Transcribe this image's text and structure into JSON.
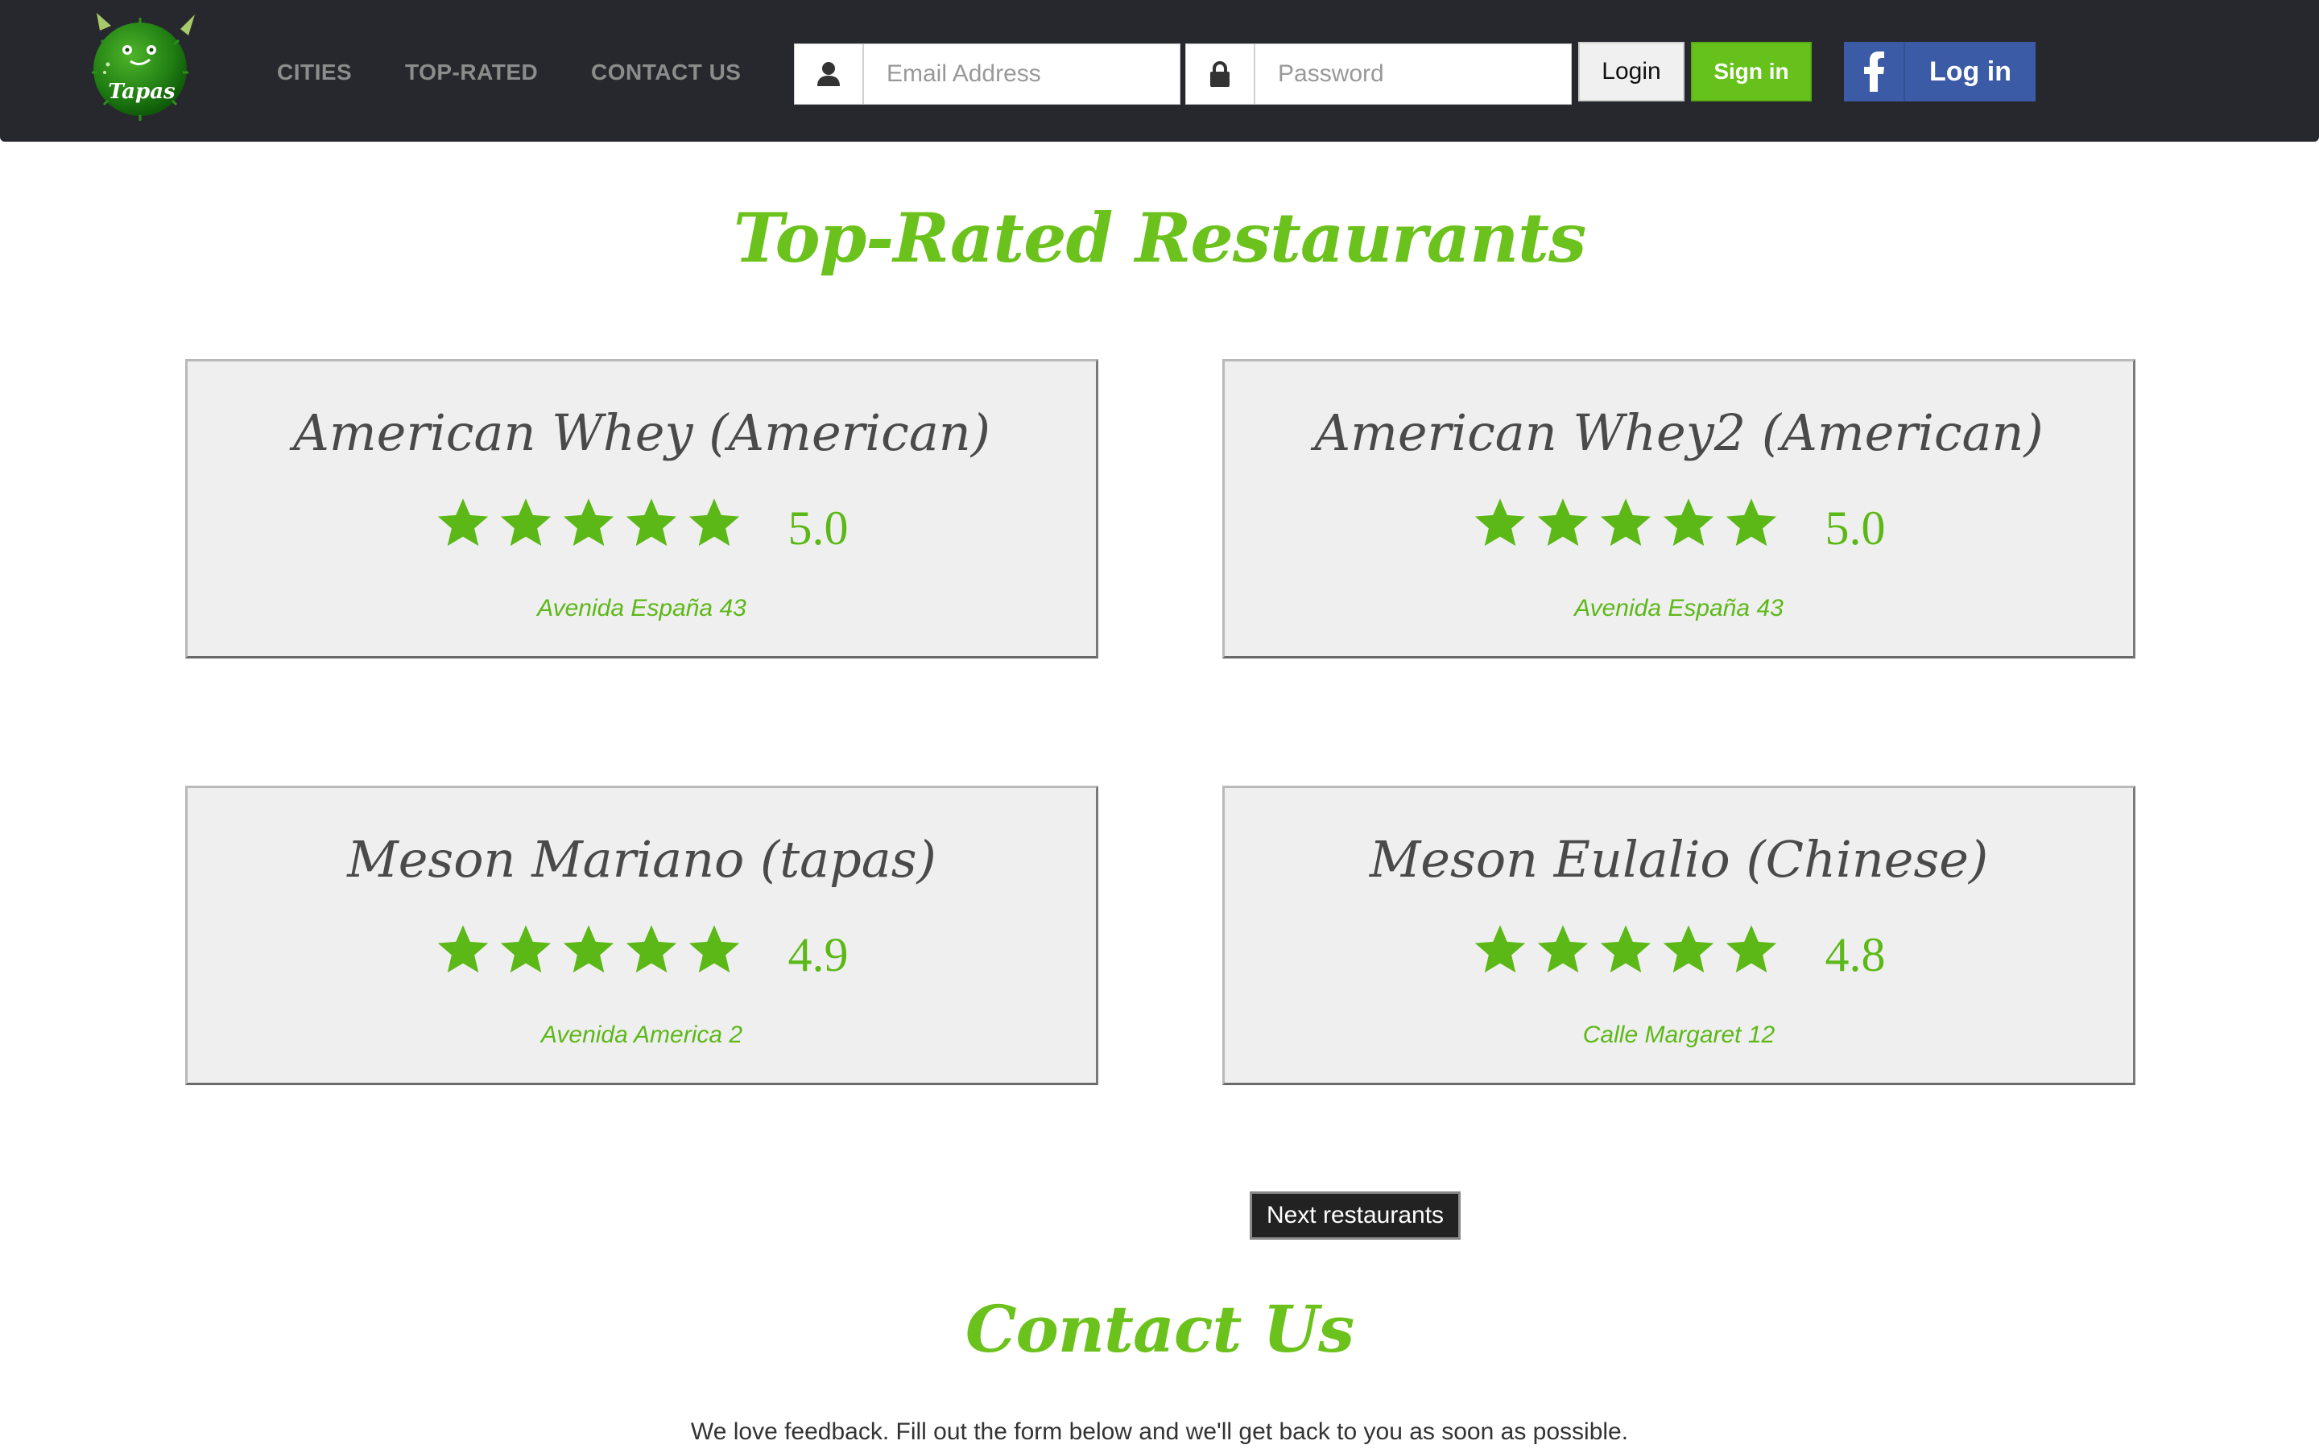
{
  "nav": {
    "links": [
      "CITIES",
      "TOP-RATED",
      "CONTACT US"
    ],
    "email_placeholder": "Email Address",
    "password_placeholder": "Password",
    "login_label": "Login",
    "signin_label": "Sign in",
    "fb_label": "Log in"
  },
  "logo_text": "Tapas",
  "top_rated": {
    "title": "Top-Rated Restaurants",
    "restaurants": [
      {
        "name": "American Whey (American)",
        "rating": "5.0",
        "stars": 5,
        "address": "Avenida España 43"
      },
      {
        "name": "American Whey2 (American)",
        "rating": "5.0",
        "stars": 5,
        "address": "Avenida España 43"
      },
      {
        "name": "Meson Mariano (tapas)",
        "rating": "4.9",
        "stars": 5,
        "address": "Avenida America 2"
      },
      {
        "name": "Meson Eulalio (Chinese)",
        "rating": "4.8",
        "stars": 5,
        "address": "Calle Margaret 12"
      }
    ],
    "next_label": "Next restaurants"
  },
  "contact": {
    "title": "Contact Us",
    "intro": "We love feedback. Fill out the form below and we'll get back to you as soon as possible."
  },
  "colors": {
    "brand_green": "#6cc21c",
    "nav_bg": "#27282d",
    "facebook": "#3b5ba7"
  }
}
